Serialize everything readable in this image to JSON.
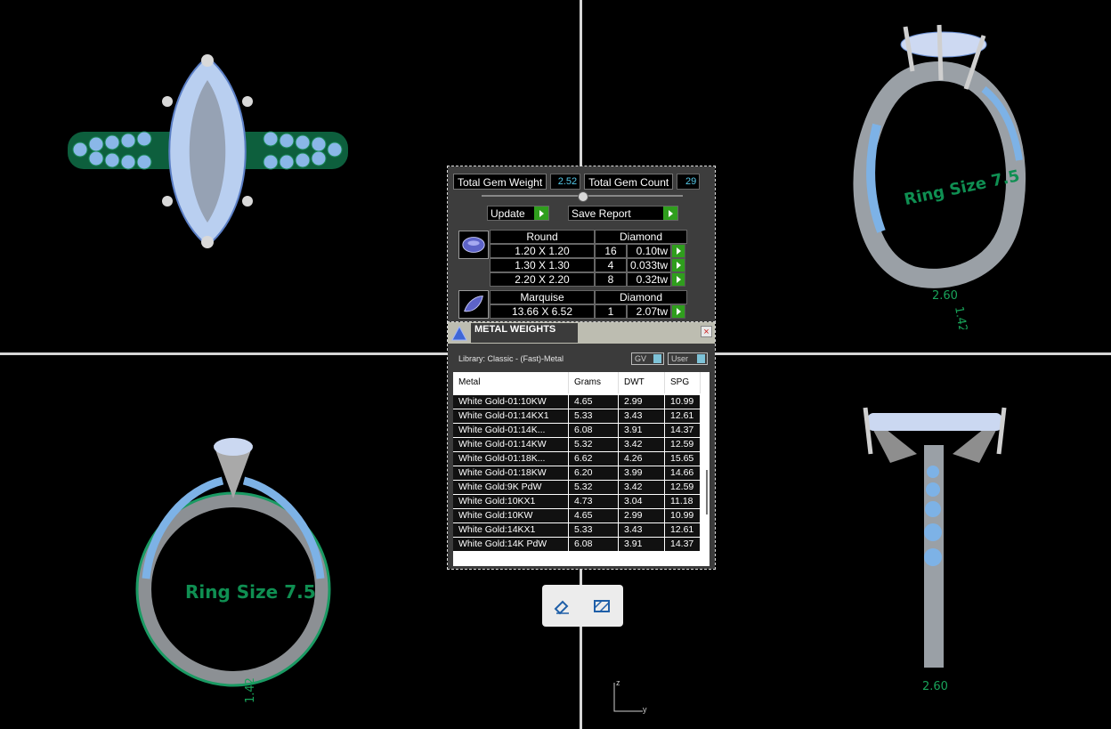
{
  "gem_report": {
    "total_weight_label": "Total Gem Weight",
    "total_weight_value": "2.52",
    "total_count_label": "Total Gem Count",
    "total_count_value": "29",
    "update_label": "Update",
    "save_report_label": "Save Report",
    "groups": [
      {
        "shape": "Round",
        "material": "Diamond",
        "rows": [
          {
            "size": "1.20 X 1.20",
            "count": "16",
            "weight": "0.10tw"
          },
          {
            "size": "1.30 X 1.30",
            "count": "4",
            "weight": "0.033tw"
          },
          {
            "size": "2.20 X 2.20",
            "count": "8",
            "weight": "0.32tw"
          }
        ]
      },
      {
        "shape": "Marquise",
        "material": "Diamond",
        "rows": [
          {
            "size": "13.66 X 6.52",
            "count": "1",
            "weight": "2.07tw"
          }
        ]
      }
    ]
  },
  "metal_weights": {
    "title": "METAL WEIGHTS",
    "close_symbol": "×",
    "library_label": "Library: Classic - (Fast)-Metal",
    "toggle_gv": "GV",
    "toggle_user": "User",
    "columns": [
      "Metal",
      "Grams",
      "DWT",
      "SPG"
    ],
    "rows": [
      {
        "metal": "White Gold-01:10KW",
        "grams": "4.65",
        "dwt": "2.99",
        "spg": "10.99"
      },
      {
        "metal": "White Gold-01:14KX1",
        "grams": "5.33",
        "dwt": "3.43",
        "spg": "12.61"
      },
      {
        "metal": "White Gold-01:14K...",
        "grams": "6.08",
        "dwt": "3.91",
        "spg": "14.37"
      },
      {
        "metal": "White Gold-01:14KW",
        "grams": "5.32",
        "dwt": "3.42",
        "spg": "12.59"
      },
      {
        "metal": "White Gold-01:18K...",
        "grams": "6.62",
        "dwt": "4.26",
        "spg": "15.65"
      },
      {
        "metal": "White Gold-01:18KW",
        "grams": "6.20",
        "dwt": "3.99",
        "spg": "14.66"
      },
      {
        "metal": "White Gold:9K PdW",
        "grams": "5.32",
        "dwt": "3.42",
        "spg": "12.59"
      },
      {
        "metal": "White Gold:10KX1",
        "grams": "4.73",
        "dwt": "3.04",
        "spg": "11.18"
      },
      {
        "metal": "White Gold:10KW",
        "grams": "4.65",
        "dwt": "2.99",
        "spg": "10.99"
      },
      {
        "metal": "White Gold:14KX1",
        "grams": "5.33",
        "dwt": "3.43",
        "spg": "12.61"
      },
      {
        "metal": "White Gold:14K PdW",
        "grams": "6.08",
        "dwt": "3.91",
        "spg": "14.37"
      }
    ]
  },
  "viewports": {
    "ring_size_label": "Ring Size 7.5",
    "dim_width": "2.60",
    "dim_height": "1.42",
    "axis_z": "z",
    "axis_y": "y"
  },
  "toolbar": {
    "tools": [
      "eraser-tool-icon",
      "hatch-tool-icon"
    ]
  },
  "colors": {
    "background": "#000000",
    "accent_green": "#2f9e1d",
    "value_cyan": "#54c8e8",
    "annotation_green": "#0f8f52"
  }
}
